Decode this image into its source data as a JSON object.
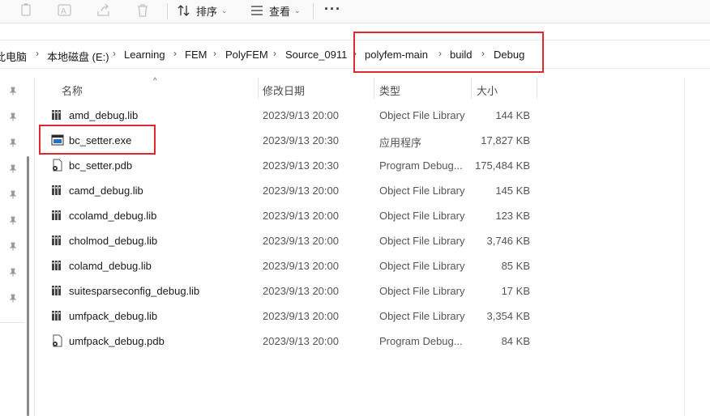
{
  "toolbar": {
    "sort_label": "排序",
    "view_label": "查看",
    "icons": [
      "copy-icon",
      "rename-icon",
      "share-icon",
      "delete-icon",
      "sort-icon",
      "view-icon",
      "more-icon"
    ],
    "more_label": "···"
  },
  "breadcrumb": {
    "items": [
      "此电脑",
      "本地磁盘 (E:)",
      "Learning",
      "FEM",
      "PolyFEM",
      "Source_0911",
      "polyfem-main",
      "build",
      "Debug"
    ],
    "separator": "›"
  },
  "columns": {
    "name": "名称",
    "date": "修改日期",
    "type": "类型",
    "size": "大小"
  },
  "files": [
    {
      "name": "amd_debug.lib",
      "date": "2023/9/13 20:00",
      "type": "Object File Library",
      "size": "144 KB",
      "icon": "lib-icon"
    },
    {
      "name": "bc_setter.exe",
      "date": "2023/9/13 20:30",
      "type": "应用程序",
      "size": "17,827 KB",
      "icon": "exe-icon"
    },
    {
      "name": "bc_setter.pdb",
      "date": "2023/9/13 20:30",
      "type": "Program Debug...",
      "size": "175,484 KB",
      "icon": "pdb-icon"
    },
    {
      "name": "camd_debug.lib",
      "date": "2023/9/13 20:00",
      "type": "Object File Library",
      "size": "145 KB",
      "icon": "lib-icon"
    },
    {
      "name": "ccolamd_debug.lib",
      "date": "2023/9/13 20:00",
      "type": "Object File Library",
      "size": "123 KB",
      "icon": "lib-icon"
    },
    {
      "name": "cholmod_debug.lib",
      "date": "2023/9/13 20:00",
      "type": "Object File Library",
      "size": "3,746 KB",
      "icon": "lib-icon"
    },
    {
      "name": "colamd_debug.lib",
      "date": "2023/9/13 20:00",
      "type": "Object File Library",
      "size": "85 KB",
      "icon": "lib-icon"
    },
    {
      "name": "suitesparseconfig_debug.lib",
      "date": "2023/9/13 20:00",
      "type": "Object File Library",
      "size": "17 KB",
      "icon": "lib-icon"
    },
    {
      "name": "umfpack_debug.lib",
      "date": "2023/9/13 20:00",
      "type": "Object File Library",
      "size": "3,354 KB",
      "icon": "lib-icon"
    },
    {
      "name": "umfpack_debug.pdb",
      "date": "2023/9/13 20:00",
      "type": "Program Debug...",
      "size": "84 KB",
      "icon": "pdb-icon"
    }
  ],
  "colors": {
    "highlight_box": "#e0282e",
    "toolbar_bg": "#f9f9f9"
  }
}
